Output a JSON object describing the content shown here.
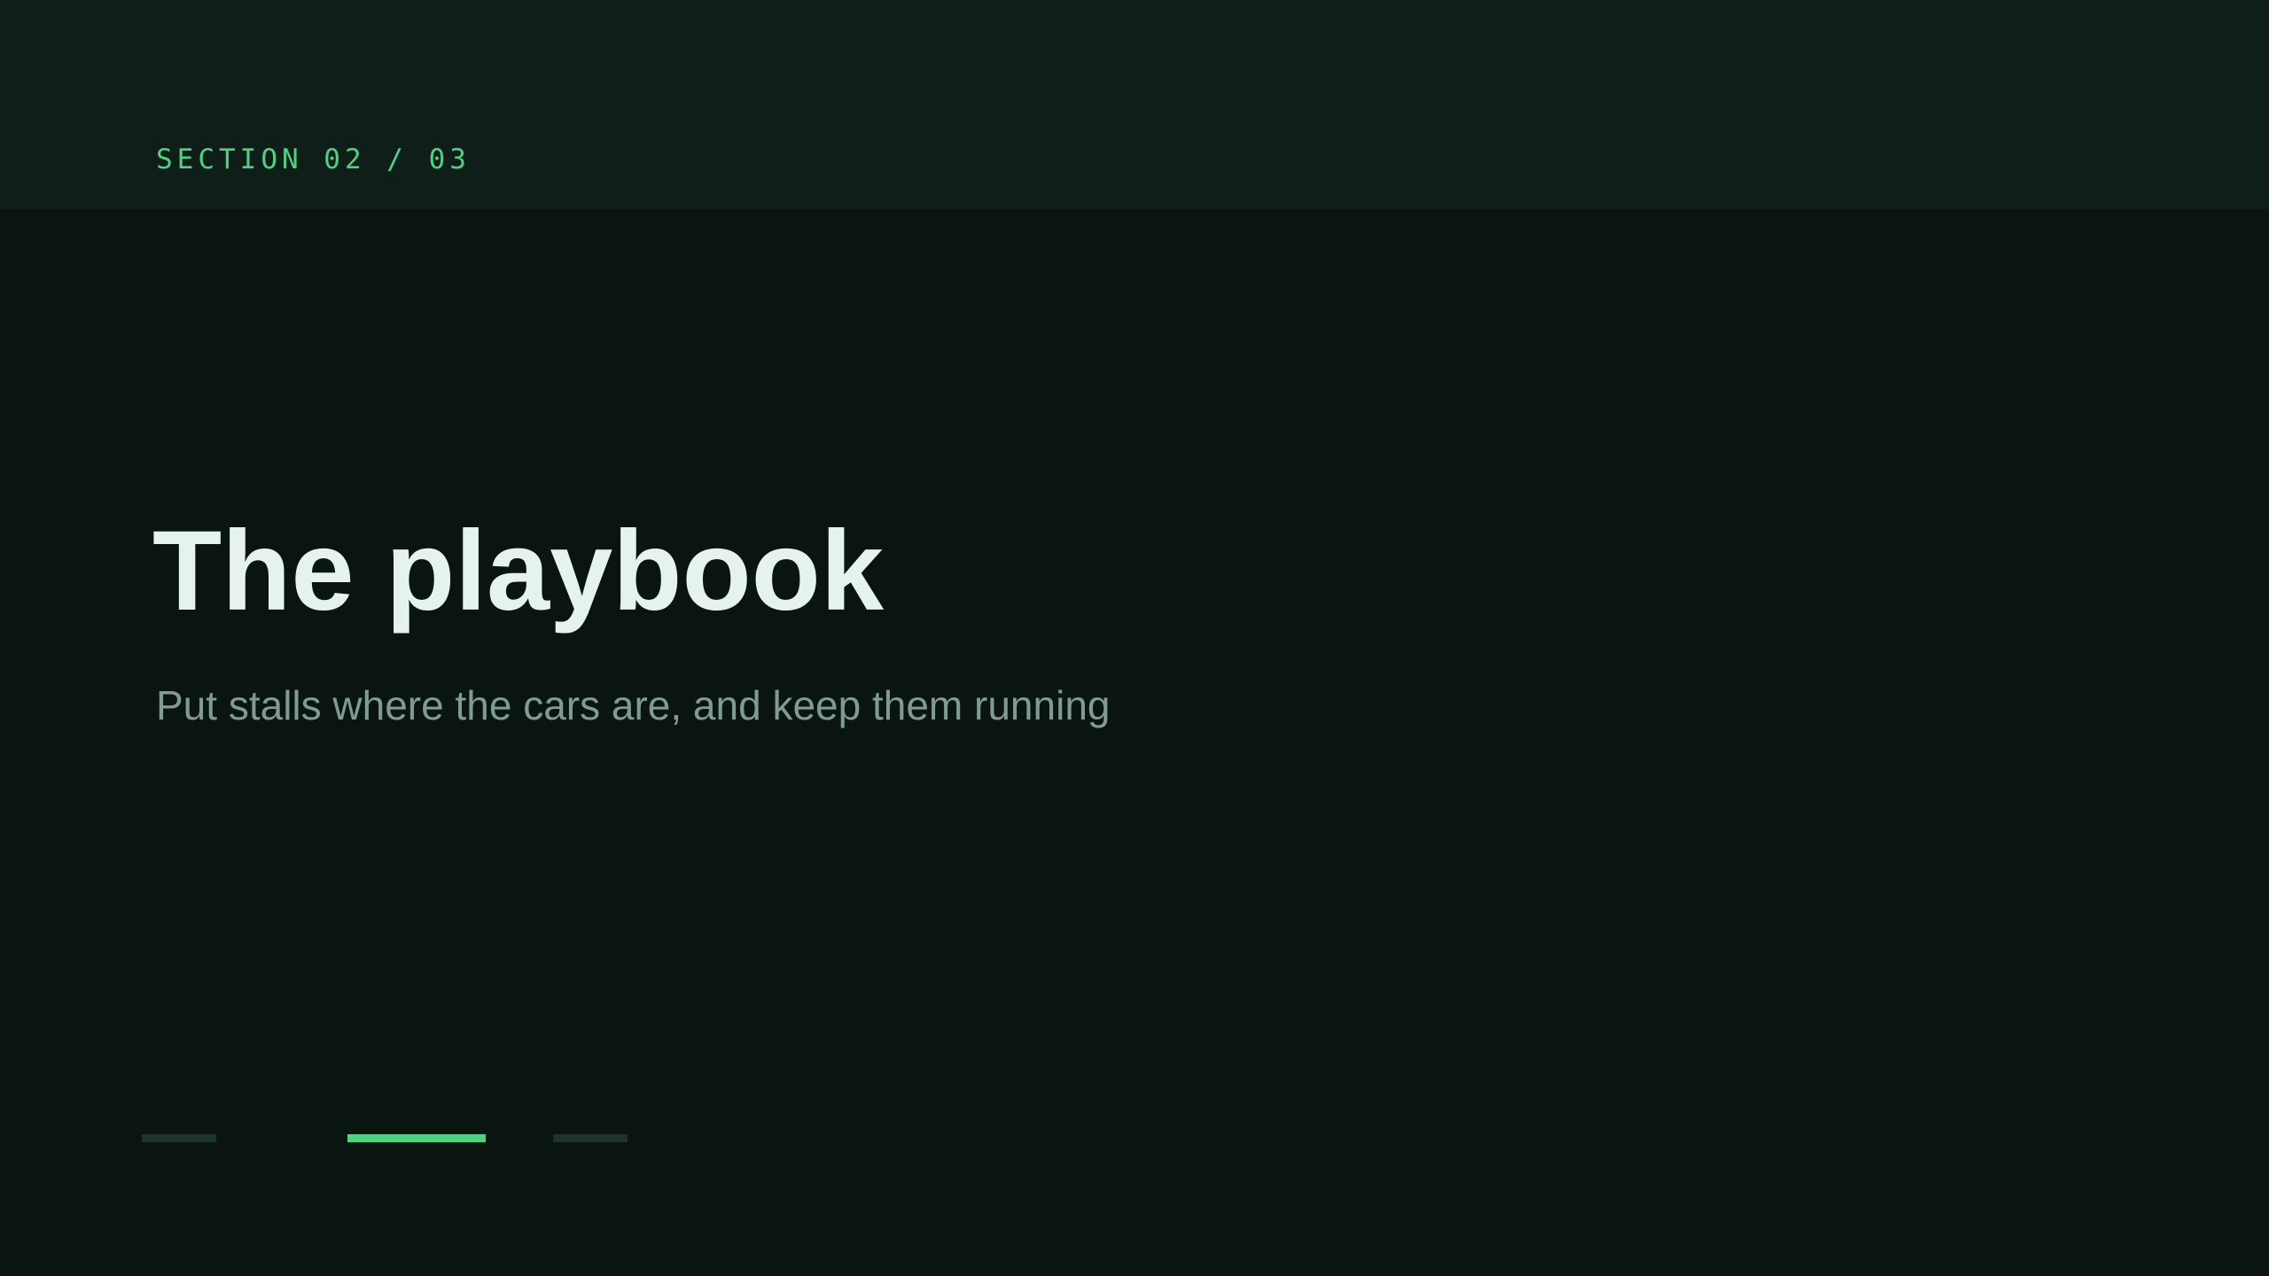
{
  "header": {
    "section_label": "SECTION 02 / 03"
  },
  "main": {
    "title": "The playbook",
    "subtitle": "Put stalls where the cars are, and keep them running"
  },
  "progress": {
    "current_section": 2,
    "total_sections": 3,
    "segments": [
      {
        "section": 1,
        "active": false
      },
      {
        "section": 2,
        "active": true
      },
      {
        "section": 3,
        "active": false
      }
    ]
  },
  "colors": {
    "background": "#0a1411",
    "header_band": "#0f1e19",
    "accent": "#4fd183",
    "title_text": "#e6f2ee",
    "subtitle_text": "#7e9c92",
    "inactive_segment": "#1e332c"
  }
}
